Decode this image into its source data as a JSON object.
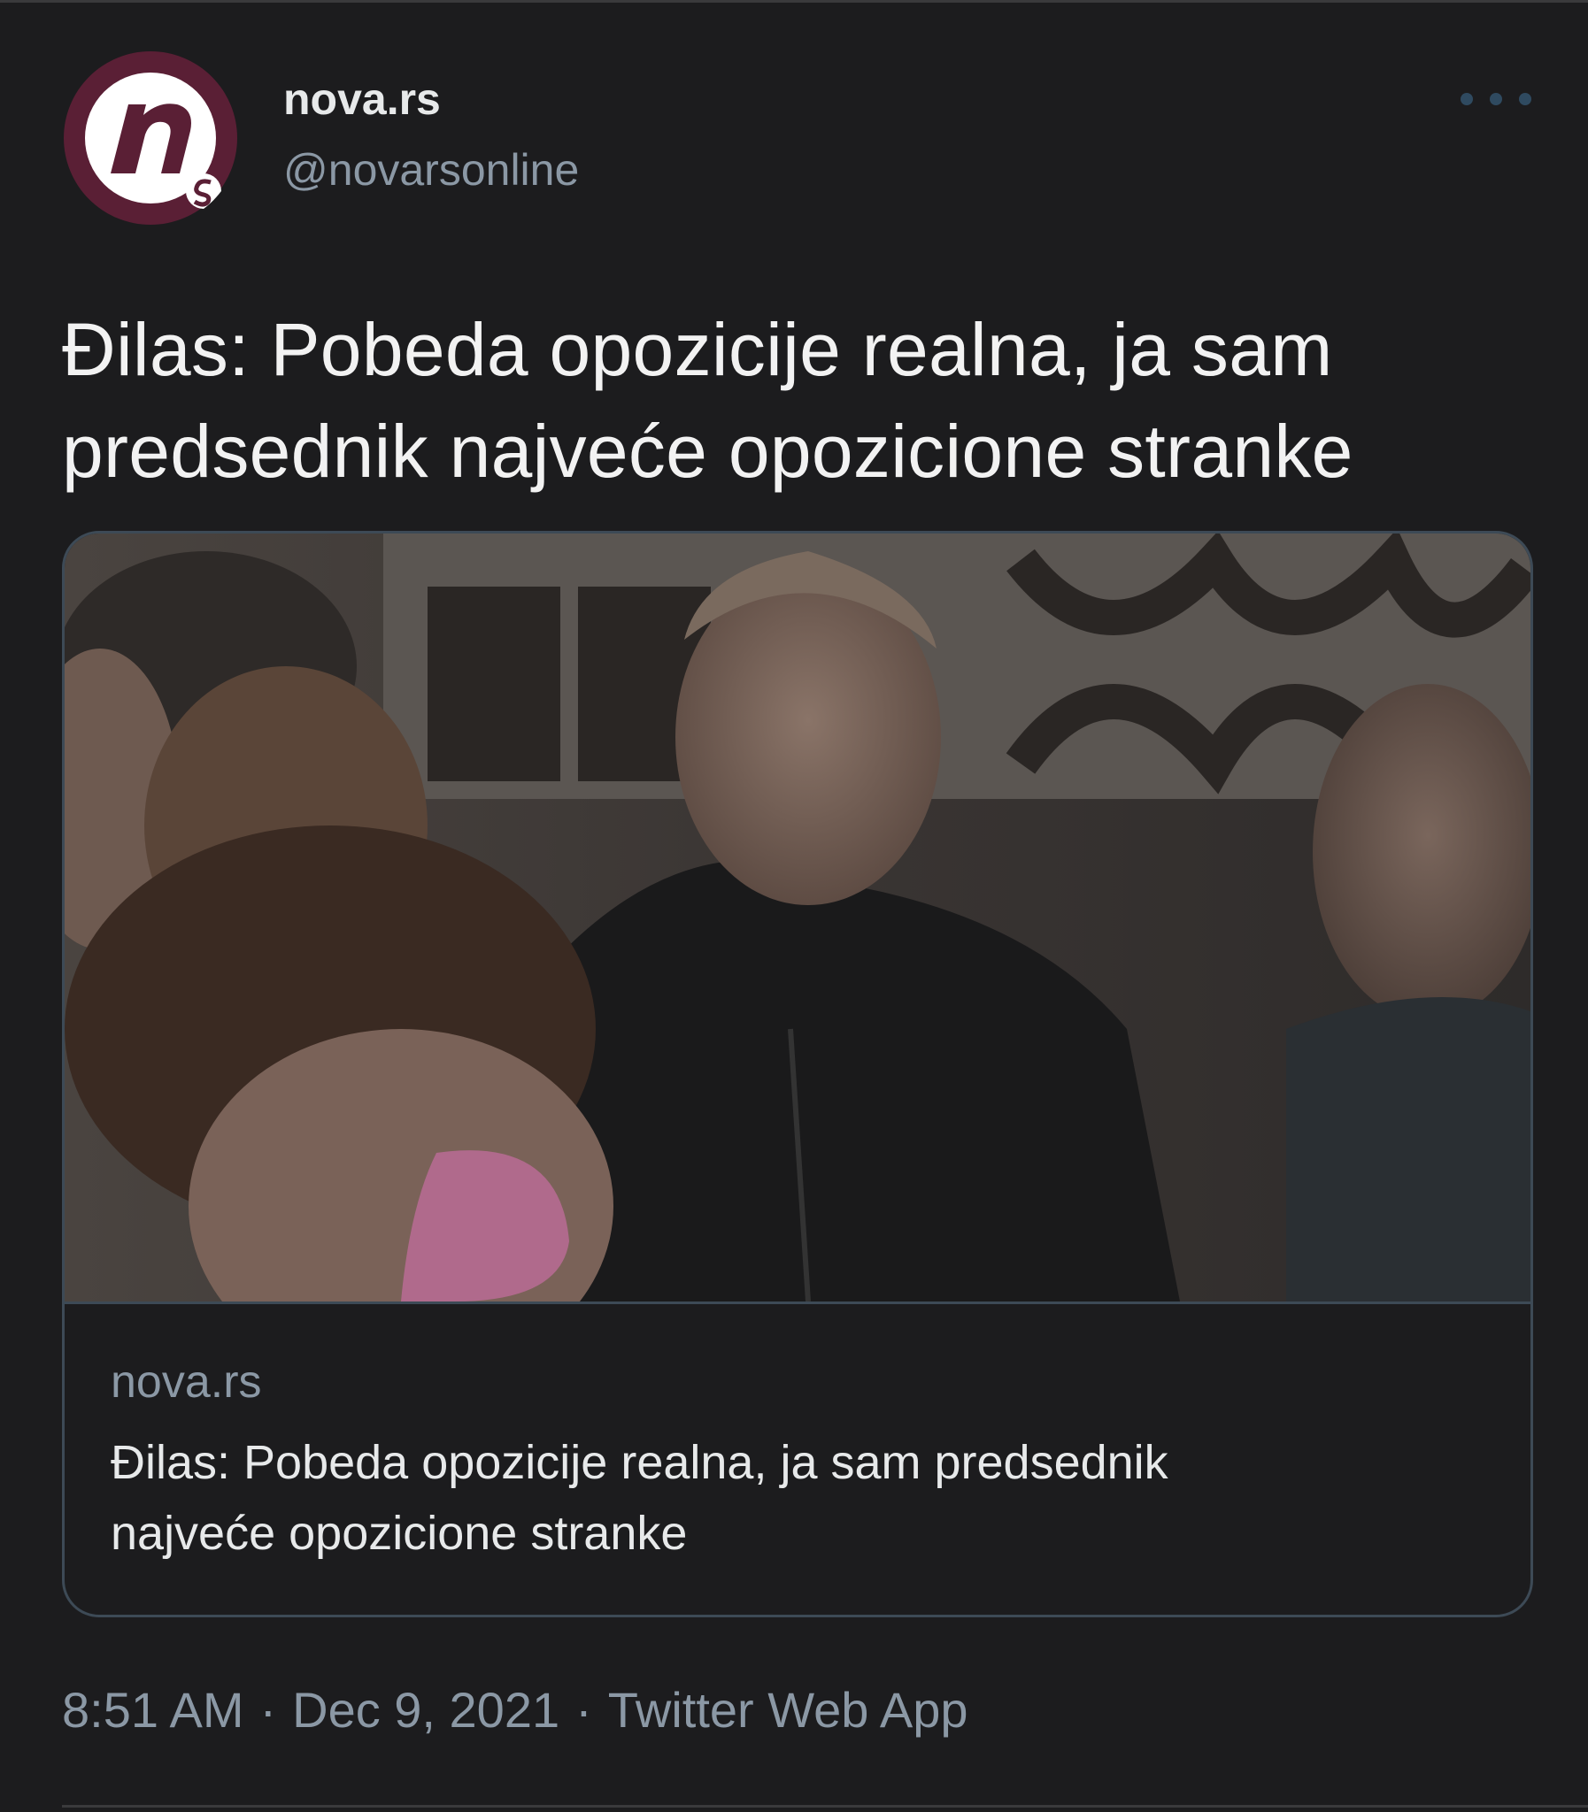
{
  "tweet": {
    "display_name": "nova.rs",
    "handle": "@novarsonline",
    "avatar_icon": "nova-rs-logo",
    "more_icon": "more-dots-icon",
    "text_line_1": "Đilas: Pobeda opozicije realna, ja sam",
    "text_line_2": "predsednik najveće opozicione stranke"
  },
  "card": {
    "domain": "nova.rs",
    "title_line_1": "Đilas: Pobeda opozicije realna, ja sam predsednik",
    "title_line_2": "najveće opozicione stranke"
  },
  "meta": {
    "time": "8:51 AM",
    "separator": "·",
    "date": "Dec 9, 2021",
    "source": "Twitter Web App"
  },
  "colors": {
    "background": "#1c1c1e",
    "text_primary": "#e7e9ea",
    "text_secondary": "#8b98a5",
    "logo_maroon": "#5a1f35",
    "border": "#3d4a56"
  }
}
